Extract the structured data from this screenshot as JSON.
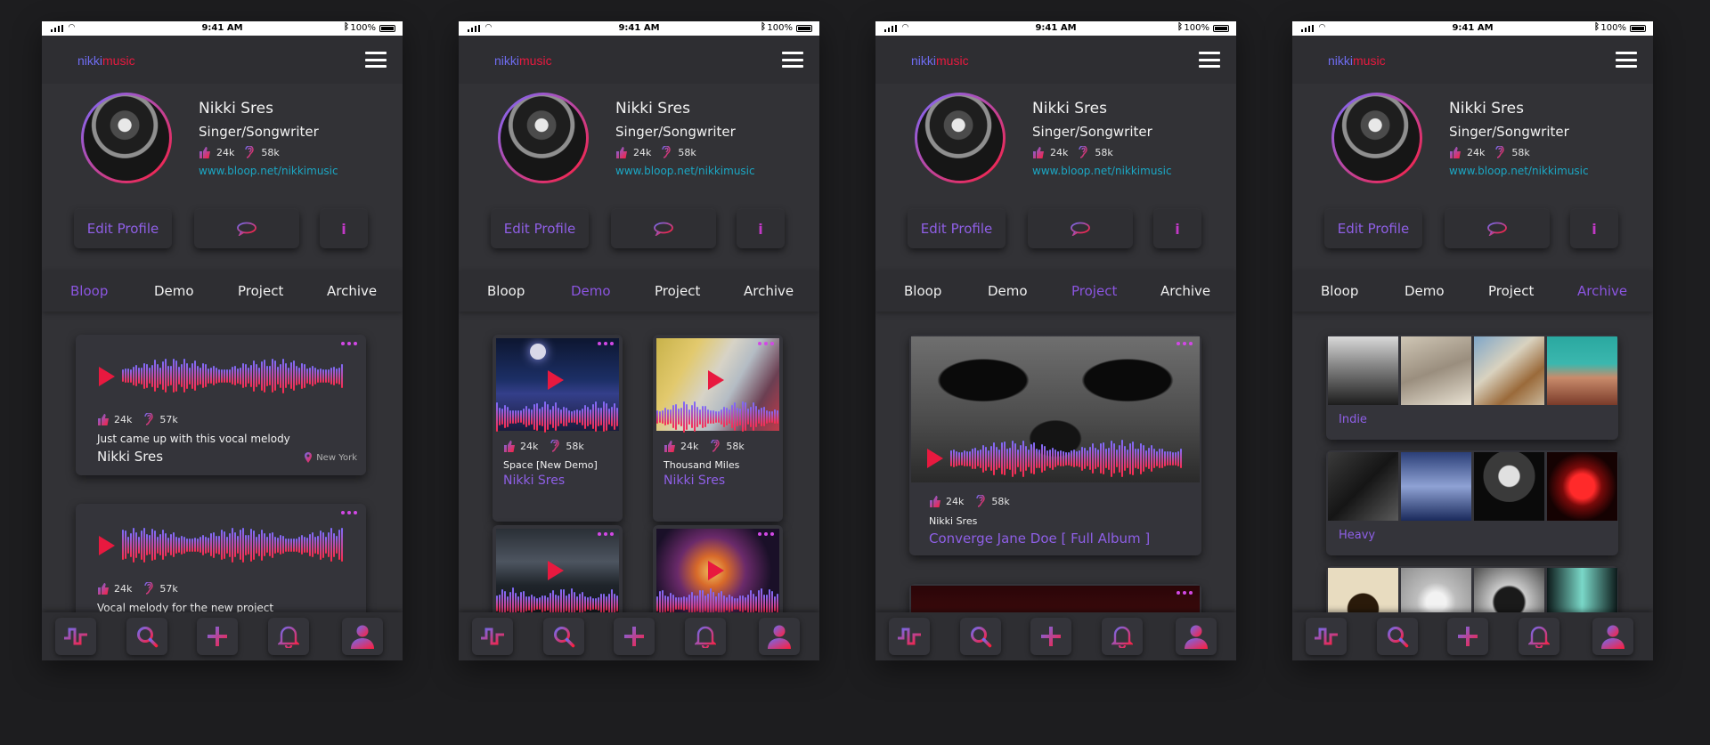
{
  "status": {
    "time": "9:41 AM",
    "battery": "100%"
  },
  "brand": {
    "part1": "nikki",
    "part2": "music"
  },
  "profile": {
    "name": "Nikki Sres",
    "role": "Singer/Songwriter",
    "likes": "24k",
    "listens": "58k",
    "link": "www.bloop.net/nikkimusic"
  },
  "buttons": {
    "edit": "Edit Profile",
    "info": "i"
  },
  "tabs": [
    "Bloop",
    "Demo",
    "Project",
    "Archive"
  ],
  "screens": [
    {
      "active_tab": 0,
      "bloops": [
        {
          "likes": "24k",
          "listens": "57k",
          "desc": "Just came up with this vocal melody",
          "artist": "Nikki Sres",
          "location": "New York"
        },
        {
          "likes": "24k",
          "listens": "57k",
          "desc": "Vocal melody for  the new project"
        }
      ]
    },
    {
      "active_tab": 1,
      "demos": [
        {
          "likes": "24k",
          "listens": "58k",
          "title": "Space [New Demo]",
          "artist": "Nikki Sres"
        },
        {
          "likes": "24k",
          "listens": "58k",
          "title": "Thousand Miles",
          "artist": "Nikki Sres"
        }
      ]
    },
    {
      "active_tab": 2,
      "project": {
        "likes": "24k",
        "listens": "58k",
        "artist": "Nikki Sres",
        "title": "Converge Jane Doe [ Full Album ]"
      }
    },
    {
      "active_tab": 3,
      "archive": [
        {
          "label": "Indie"
        },
        {
          "label": "Heavy"
        }
      ]
    }
  ],
  "colors": {
    "accent_blue": "#6f6cf0",
    "accent_red": "#e8193f",
    "accent_purple": "#8e5fe6",
    "link": "#1ba7c4",
    "background": "#1d1d1f",
    "panel": "#323236"
  },
  "icons": [
    "pulse-icon",
    "search-icon",
    "plus-icon",
    "bell-icon",
    "user-icon",
    "thumbs-up-icon",
    "ear-icon",
    "chat-bubble-icon",
    "location-pin-icon",
    "play-icon",
    "more-dots-icon",
    "menu-icon"
  ]
}
